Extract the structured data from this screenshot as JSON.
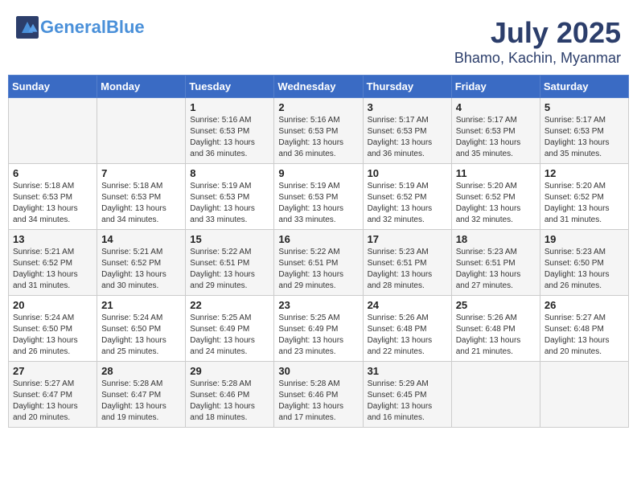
{
  "header": {
    "logo_general": "General",
    "logo_blue": "Blue",
    "month": "July 2025",
    "location": "Bhamo, Kachin, Myanmar"
  },
  "weekdays": [
    "Sunday",
    "Monday",
    "Tuesday",
    "Wednesday",
    "Thursday",
    "Friday",
    "Saturday"
  ],
  "weeks": [
    [
      {
        "day": "",
        "info": ""
      },
      {
        "day": "",
        "info": ""
      },
      {
        "day": "1",
        "info": "Sunrise: 5:16 AM\nSunset: 6:53 PM\nDaylight: 13 hours and 36 minutes."
      },
      {
        "day": "2",
        "info": "Sunrise: 5:16 AM\nSunset: 6:53 PM\nDaylight: 13 hours and 36 minutes."
      },
      {
        "day": "3",
        "info": "Sunrise: 5:17 AM\nSunset: 6:53 PM\nDaylight: 13 hours and 36 minutes."
      },
      {
        "day": "4",
        "info": "Sunrise: 5:17 AM\nSunset: 6:53 PM\nDaylight: 13 hours and 35 minutes."
      },
      {
        "day": "5",
        "info": "Sunrise: 5:17 AM\nSunset: 6:53 PM\nDaylight: 13 hours and 35 minutes."
      }
    ],
    [
      {
        "day": "6",
        "info": "Sunrise: 5:18 AM\nSunset: 6:53 PM\nDaylight: 13 hours and 34 minutes."
      },
      {
        "day": "7",
        "info": "Sunrise: 5:18 AM\nSunset: 6:53 PM\nDaylight: 13 hours and 34 minutes."
      },
      {
        "day": "8",
        "info": "Sunrise: 5:19 AM\nSunset: 6:53 PM\nDaylight: 13 hours and 33 minutes."
      },
      {
        "day": "9",
        "info": "Sunrise: 5:19 AM\nSunset: 6:53 PM\nDaylight: 13 hours and 33 minutes."
      },
      {
        "day": "10",
        "info": "Sunrise: 5:19 AM\nSunset: 6:52 PM\nDaylight: 13 hours and 32 minutes."
      },
      {
        "day": "11",
        "info": "Sunrise: 5:20 AM\nSunset: 6:52 PM\nDaylight: 13 hours and 32 minutes."
      },
      {
        "day": "12",
        "info": "Sunrise: 5:20 AM\nSunset: 6:52 PM\nDaylight: 13 hours and 31 minutes."
      }
    ],
    [
      {
        "day": "13",
        "info": "Sunrise: 5:21 AM\nSunset: 6:52 PM\nDaylight: 13 hours and 31 minutes."
      },
      {
        "day": "14",
        "info": "Sunrise: 5:21 AM\nSunset: 6:52 PM\nDaylight: 13 hours and 30 minutes."
      },
      {
        "day": "15",
        "info": "Sunrise: 5:22 AM\nSunset: 6:51 PM\nDaylight: 13 hours and 29 minutes."
      },
      {
        "day": "16",
        "info": "Sunrise: 5:22 AM\nSunset: 6:51 PM\nDaylight: 13 hours and 29 minutes."
      },
      {
        "day": "17",
        "info": "Sunrise: 5:23 AM\nSunset: 6:51 PM\nDaylight: 13 hours and 28 minutes."
      },
      {
        "day": "18",
        "info": "Sunrise: 5:23 AM\nSunset: 6:51 PM\nDaylight: 13 hours and 27 minutes."
      },
      {
        "day": "19",
        "info": "Sunrise: 5:23 AM\nSunset: 6:50 PM\nDaylight: 13 hours and 26 minutes."
      }
    ],
    [
      {
        "day": "20",
        "info": "Sunrise: 5:24 AM\nSunset: 6:50 PM\nDaylight: 13 hours and 26 minutes."
      },
      {
        "day": "21",
        "info": "Sunrise: 5:24 AM\nSunset: 6:50 PM\nDaylight: 13 hours and 25 minutes."
      },
      {
        "day": "22",
        "info": "Sunrise: 5:25 AM\nSunset: 6:49 PM\nDaylight: 13 hours and 24 minutes."
      },
      {
        "day": "23",
        "info": "Sunrise: 5:25 AM\nSunset: 6:49 PM\nDaylight: 13 hours and 23 minutes."
      },
      {
        "day": "24",
        "info": "Sunrise: 5:26 AM\nSunset: 6:48 PM\nDaylight: 13 hours and 22 minutes."
      },
      {
        "day": "25",
        "info": "Sunrise: 5:26 AM\nSunset: 6:48 PM\nDaylight: 13 hours and 21 minutes."
      },
      {
        "day": "26",
        "info": "Sunrise: 5:27 AM\nSunset: 6:48 PM\nDaylight: 13 hours and 20 minutes."
      }
    ],
    [
      {
        "day": "27",
        "info": "Sunrise: 5:27 AM\nSunset: 6:47 PM\nDaylight: 13 hours and 20 minutes."
      },
      {
        "day": "28",
        "info": "Sunrise: 5:28 AM\nSunset: 6:47 PM\nDaylight: 13 hours and 19 minutes."
      },
      {
        "day": "29",
        "info": "Sunrise: 5:28 AM\nSunset: 6:46 PM\nDaylight: 13 hours and 18 minutes."
      },
      {
        "day": "30",
        "info": "Sunrise: 5:28 AM\nSunset: 6:46 PM\nDaylight: 13 hours and 17 minutes."
      },
      {
        "day": "31",
        "info": "Sunrise: 5:29 AM\nSunset: 6:45 PM\nDaylight: 13 hours and 16 minutes."
      },
      {
        "day": "",
        "info": ""
      },
      {
        "day": "",
        "info": ""
      }
    ]
  ]
}
